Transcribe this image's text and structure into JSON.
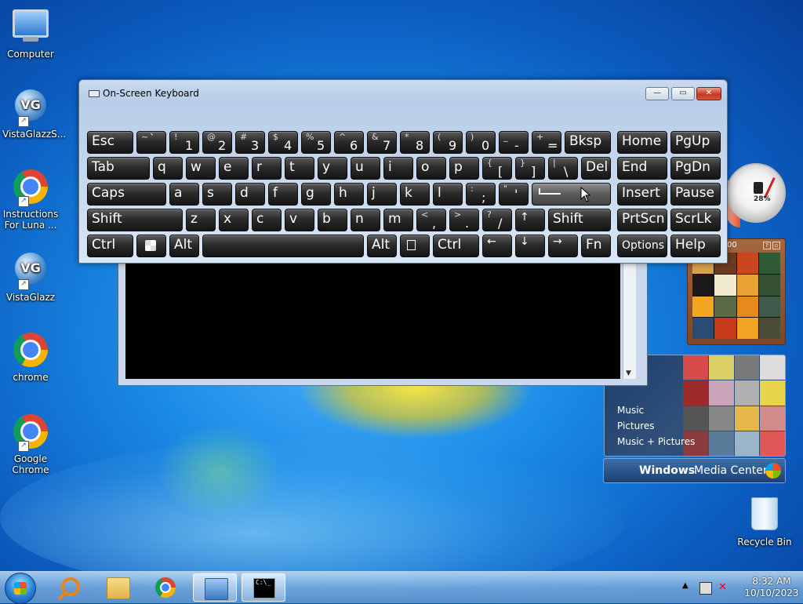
{
  "desktop": {
    "icons": [
      {
        "label": "Computer"
      },
      {
        "label": "VistaGlazzS..."
      },
      {
        "label": "Instructions For Luna ..."
      },
      {
        "label": "VistaGlazz"
      },
      {
        "label": "chrome"
      },
      {
        "label": "Google Chrome"
      },
      {
        "label": "Recycle Bin"
      }
    ]
  },
  "osk": {
    "title": "On-Screen Keyboard",
    "caption_buttons": {
      "minimize": "—",
      "maximize": "▭",
      "close": "✕"
    },
    "keys": {
      "esc": "Esc",
      "bksp": "Bksp",
      "home": "Home",
      "pgup": "PgUp",
      "tab": "Tab",
      "del": "Del",
      "end": "End",
      "pgdn": "PgDn",
      "caps": "Caps",
      "insert": "Insert",
      "pause": "Pause",
      "shift": "Shift",
      "prtscn": "PrtScn",
      "scrlk": "ScrLk",
      "ctrl": "Ctrl",
      "alt": "Alt",
      "fn": "Fn",
      "options": "Options",
      "help": "Help",
      "row1": [
        {
          "top": "~",
          "main": "`"
        },
        {
          "top": "!",
          "main": "1"
        },
        {
          "top": "@",
          "main": "2"
        },
        {
          "top": "#",
          "main": "3"
        },
        {
          "top": "$",
          "main": "4"
        },
        {
          "top": "%",
          "main": "5"
        },
        {
          "top": "^",
          "main": "6"
        },
        {
          "top": "&",
          "main": "7"
        },
        {
          "top": "*",
          "main": "8"
        },
        {
          "top": "(",
          "main": "9"
        },
        {
          "top": ")",
          "main": "0"
        },
        {
          "top": "_",
          "main": "-"
        },
        {
          "top": "+",
          "main": "="
        }
      ],
      "row2": [
        "q",
        "w",
        "e",
        "r",
        "t",
        "y",
        "u",
        "i",
        "o",
        "p"
      ],
      "row2_sym": [
        {
          "top": "{",
          "main": "["
        },
        {
          "top": "}",
          "main": "]"
        },
        {
          "top": "|",
          "main": "\\"
        }
      ],
      "row3": [
        "a",
        "s",
        "d",
        "f",
        "g",
        "h",
        "j",
        "k",
        "l"
      ],
      "row3_sym": [
        {
          "top": ":",
          "main": ";"
        },
        {
          "top": "\"",
          "main": "'"
        }
      ],
      "row4": [
        "z",
        "x",
        "c",
        "v",
        "b",
        "n",
        "m"
      ],
      "row4_sym": [
        {
          "top": "<",
          "main": ","
        },
        {
          "top": ">",
          "main": "."
        },
        {
          "top": "?",
          "main": "/"
        }
      ],
      "arrows": {
        "up": "↑",
        "left": "←",
        "down": "↓",
        "right": "→"
      }
    }
  },
  "gadgets": {
    "cpu_meter_percent": "28%",
    "puzzle_title": "00",
    "media_center": {
      "items": [
        "Music",
        "Pictures",
        "Music + Pictures"
      ],
      "brand_bold": "Windows",
      "brand_regular": "Media Center"
    }
  },
  "taskbar": {
    "cmd_glyph": "C:\\_",
    "clock_time": "8:32 AM",
    "clock_date": "10/10/2023"
  },
  "colors": {
    "wallpaper_center": "#4fb3ff",
    "wallpaper_edge": "#073f99",
    "key_face": "#2b2b2b",
    "close_button": "#c23a22"
  }
}
